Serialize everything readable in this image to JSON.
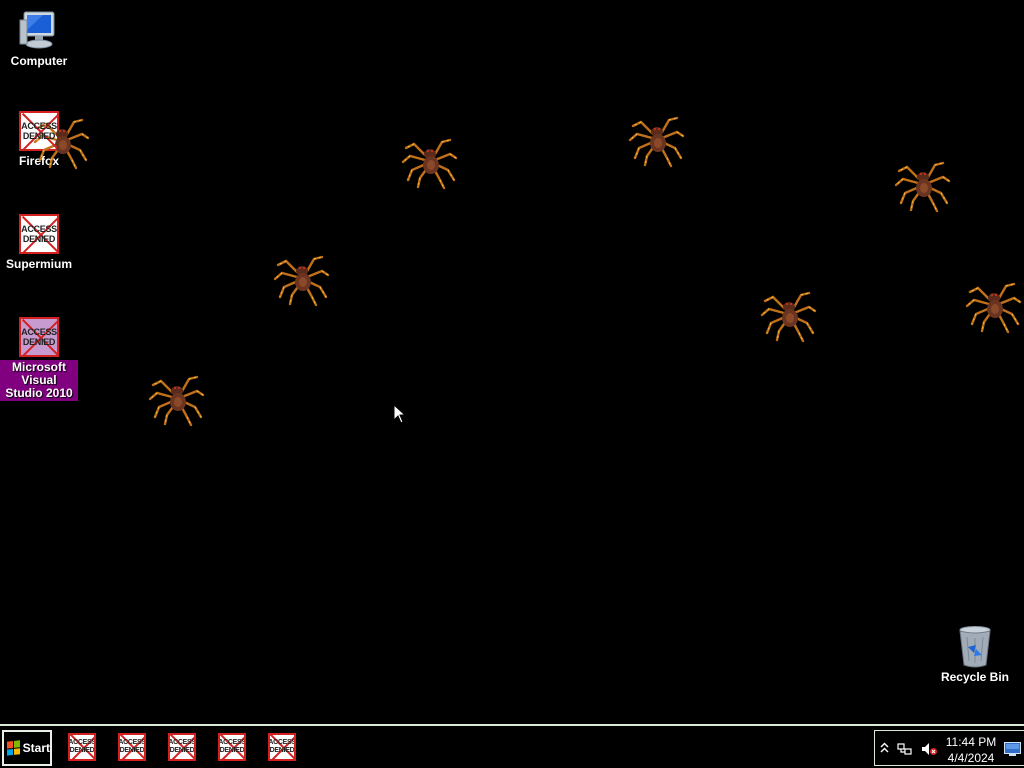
{
  "desktop": {
    "icons": [
      {
        "label": "Computer",
        "icon": "computer-icon"
      },
      {
        "label": "Firefox",
        "icon": "access-denied-icon",
        "badge": "ACCESS DENIED"
      },
      {
        "label": "Supermium",
        "icon": "access-denied-icon",
        "badge": "ACCESS DENIED"
      },
      {
        "label": "Microsoft Visual Studio 2010",
        "icon": "access-denied-icon",
        "badge": "ACCESS DENIED",
        "selected": true
      },
      {
        "label": "Recycle Bin",
        "icon": "recycle-bin-icon"
      }
    ],
    "background_color": "#000000",
    "selection_color": "#800080"
  },
  "taskbar": {
    "start_label": "Start",
    "items": [
      {
        "badge": "ACCESS DENIED"
      },
      {
        "badge": "ACCESS DENIED"
      },
      {
        "badge": "ACCESS DENIED"
      },
      {
        "badge": "ACCESS DENIED"
      },
      {
        "badge": "ACCESS DENIED"
      }
    ],
    "tray": {
      "icons": [
        "show-hidden-icons-chevron",
        "network-icon",
        "volume-muted-icon",
        "show-desktop-icon"
      ],
      "time": "11:44 PM",
      "date": "4/4/2024"
    }
  }
}
